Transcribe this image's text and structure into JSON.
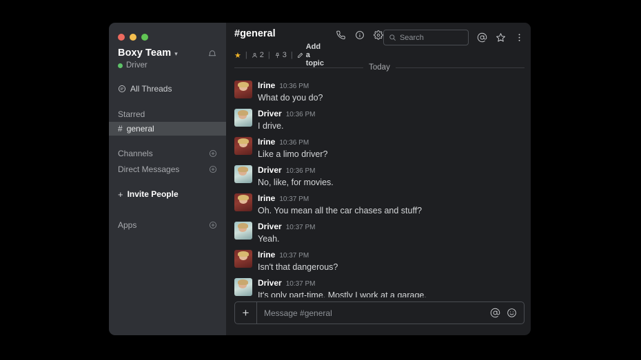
{
  "window": {
    "traffic_lights": [
      "close",
      "minimize",
      "maximize"
    ]
  },
  "sidebar": {
    "team_name": "Boxy Team",
    "team_chevron": "▾",
    "presence_user": "Driver",
    "presence_status_color": "#5ec269",
    "notifications_icon": "bell-icon",
    "all_threads": "All Threads",
    "starred_label": "Starred",
    "starred_channels": [
      {
        "hash": "#",
        "name": "general",
        "active": true
      }
    ],
    "lists": [
      {
        "label": "Channels",
        "add_icon": "plus-circle-icon"
      },
      {
        "label": "Direct Messages",
        "add_icon": "plus-circle-icon"
      }
    ],
    "invite": {
      "plus": "+",
      "label": "Invite People"
    },
    "apps": {
      "label": "Apps",
      "add_icon": "plus-circle-icon"
    }
  },
  "header": {
    "channel_title": "#general",
    "starred_icon": "star-filled-icon",
    "members_icon": "person-icon",
    "members_count": "2",
    "pins_icon": "pin-icon",
    "pins_count": "3",
    "topic_icon": "pencil-icon",
    "topic_label": "Add a topic",
    "separator": "|",
    "action_icons": [
      "phone-icon",
      "info-circle-icon",
      "gear-icon"
    ],
    "search": {
      "icon": "search-icon",
      "placeholder": "Search",
      "value": ""
    },
    "right_icons": [
      "mention-icon",
      "star-outline-icon",
      "kebab-menu-icon"
    ]
  },
  "conversation": {
    "divider_label": "Today",
    "messages": [
      {
        "author": "Irine",
        "avatar": "irine",
        "time": "10:36 PM",
        "text": "What do you do?"
      },
      {
        "author": "Driver",
        "avatar": "driver",
        "time": "10:36 PM",
        "text": "I drive."
      },
      {
        "author": "Irine",
        "avatar": "irine",
        "time": "10:36 PM",
        "text": "Like a limo driver?"
      },
      {
        "author": "Driver",
        "avatar": "driver",
        "time": "10:36 PM",
        "text": "No, like, for movies."
      },
      {
        "author": "Irine",
        "avatar": "irine",
        "time": "10:37 PM",
        "text": "Oh. You mean all the car chases and stuff?"
      },
      {
        "author": "Driver",
        "avatar": "driver",
        "time": "10:37 PM",
        "text": "Yeah."
      },
      {
        "author": "Irine",
        "avatar": "irine",
        "time": "10:37 PM",
        "text": "Isn't that dangerous?"
      },
      {
        "author": "Driver",
        "avatar": "driver",
        "time": "10:37 PM",
        "text": "It's only part-time. Mostly I work at a garage."
      }
    ]
  },
  "composer": {
    "plus_icon": "plus-icon",
    "placeholder": "Message #general",
    "value": "",
    "icons": [
      "mention-icon",
      "emoji-icon"
    ]
  },
  "colors": {
    "sidebar_bg": "#2f3136",
    "main_bg": "#1e1f22",
    "active_row": "#484b4f",
    "accent_star": "#f0b429",
    "presence_green": "#5ec269",
    "page_bg": "#000000"
  }
}
